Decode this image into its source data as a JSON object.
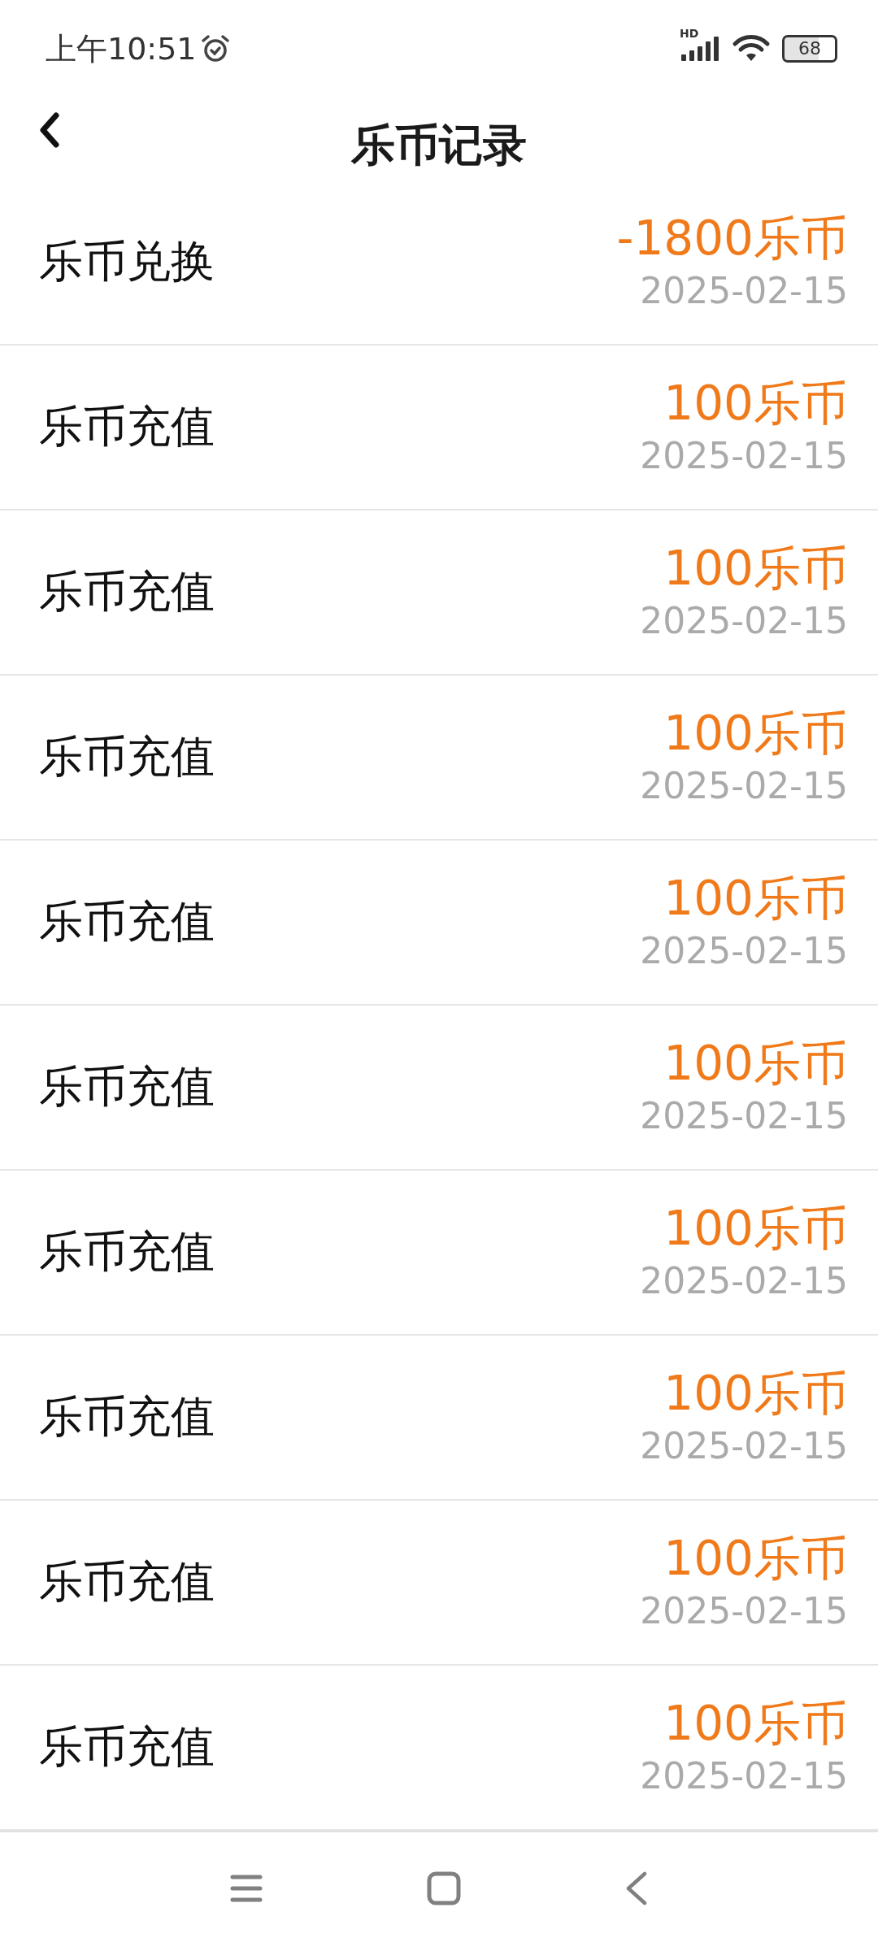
{
  "status_bar": {
    "time": "上午10:51",
    "network": "HD",
    "battery": "68"
  },
  "header": {
    "title": "乐币记录"
  },
  "records": [
    {
      "label": "乐币兑换",
      "amount": "-1800乐币",
      "date": "2025-02-15"
    },
    {
      "label": "乐币充值",
      "amount": "100乐币",
      "date": "2025-02-15"
    },
    {
      "label": "乐币充值",
      "amount": "100乐币",
      "date": "2025-02-15"
    },
    {
      "label": "乐币充值",
      "amount": "100乐币",
      "date": "2025-02-15"
    },
    {
      "label": "乐币充值",
      "amount": "100乐币",
      "date": "2025-02-15"
    },
    {
      "label": "乐币充值",
      "amount": "100乐币",
      "date": "2025-02-15"
    },
    {
      "label": "乐币充值",
      "amount": "100乐币",
      "date": "2025-02-15"
    },
    {
      "label": "乐币充值",
      "amount": "100乐币",
      "date": "2025-02-15"
    },
    {
      "label": "乐币充值",
      "amount": "100乐币",
      "date": "2025-02-15"
    },
    {
      "label": "乐币充值",
      "amount": "100乐币",
      "date": "2025-02-15"
    }
  ]
}
